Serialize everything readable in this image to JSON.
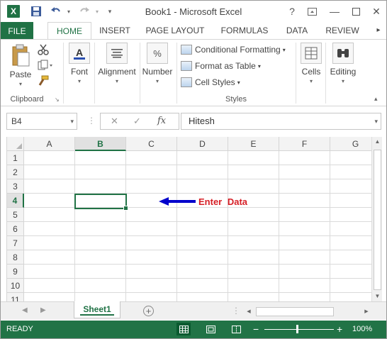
{
  "window": {
    "title": "Book1 - Microsoft Excel",
    "app_icon_letter": "X"
  },
  "title_controls": {
    "help": "?",
    "minimize": "—",
    "close": "✕"
  },
  "ribbon_tabs": [
    {
      "label": "FILE"
    },
    {
      "label": "HOME"
    },
    {
      "label": "INSERT"
    },
    {
      "label": "PAGE LAYOUT"
    },
    {
      "label": "FORMULAS"
    },
    {
      "label": "DATA"
    },
    {
      "label": "REVIEW"
    }
  ],
  "ribbon": {
    "clipboard": {
      "paste": "Paste",
      "group_label": "Clipboard"
    },
    "font": {
      "label": "Font"
    },
    "alignment": {
      "label": "Alignment"
    },
    "number": {
      "label": "Number",
      "icon_glyph": "%"
    },
    "styles": {
      "conditional_formatting": "Conditional Formatting",
      "format_as_table": "Format as Table",
      "cell_styles": "Cell Styles",
      "group_label": "Styles"
    },
    "cells": {
      "label": "Cells"
    },
    "editing": {
      "label": "Editing"
    }
  },
  "formula_bar": {
    "name_box": "B4",
    "fx_symbol": "fx",
    "formula_value": "Hitesh"
  },
  "grid": {
    "columns": [
      "A",
      "B",
      "C",
      "D",
      "E",
      "F",
      "G"
    ],
    "rows": [
      "1",
      "2",
      "3",
      "4",
      "5",
      "6",
      "7",
      "8",
      "9",
      "10",
      "11"
    ],
    "selected_column": "B",
    "selected_row": "4",
    "annotation": "Enter  Data",
    "annotation_color": "#d61f26",
    "arrow_color": "#0000cc"
  },
  "sheets": {
    "tabs": [
      {
        "label": "Sheet1"
      }
    ],
    "add_symbol": "+"
  },
  "status_bar": {
    "status": "READY",
    "zoom": "100%",
    "zoom_minus": "−",
    "zoom_plus": "+",
    "zoom_level": 1.0
  },
  "colors": {
    "accent": "#217346",
    "file_tab": "#207245"
  }
}
